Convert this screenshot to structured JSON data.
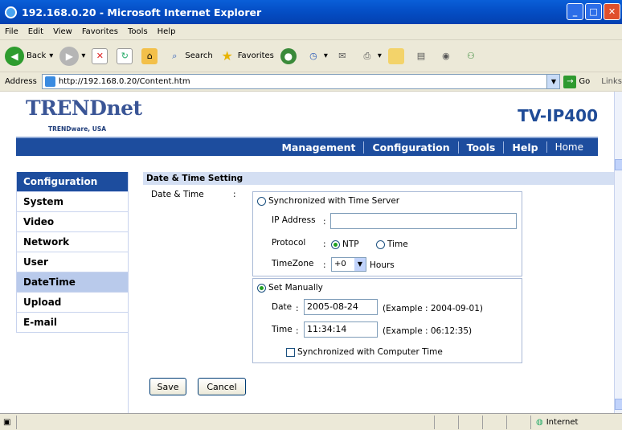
{
  "window": {
    "title": "192.168.0.20 - Microsoft Internet Explorer"
  },
  "menu": [
    "File",
    "Edit",
    "View",
    "Favorites",
    "Tools",
    "Help"
  ],
  "toolbar": {
    "back": "Back",
    "search": "Search",
    "favorites": "Favorites"
  },
  "address": {
    "label": "Address",
    "url": "http://192.168.0.20/Content.htm",
    "go": "Go",
    "links": "Links"
  },
  "brand": {
    "logo": "TRENDnet",
    "tagline": "TRENDware, USA",
    "model": "TV-IP400"
  },
  "nav": [
    "Management",
    "Configuration",
    "Tools",
    "Help",
    "Home"
  ],
  "sidebar": {
    "header": "Configuration",
    "items": [
      "System",
      "Video",
      "Network",
      "User",
      "DateTime",
      "Upload",
      "E-mail"
    ],
    "active": "DateTime"
  },
  "datetime": {
    "section_title": "Date & Time Setting",
    "label": "Date & Time",
    "colon": ":",
    "sync_server_label": "Synchronized with Time Server",
    "ip_label": "IP Address",
    "ip_value": "",
    "protocol_label": "Protocol",
    "protocol_ntp": "NTP",
    "protocol_time": "Time",
    "protocol_selected": "NTP",
    "timezone_label": "TimeZone",
    "timezone_value": "+0",
    "timezone_unit": "Hours",
    "manual_label": "Set Manually",
    "mode_selected": "manual",
    "date_label": "Date",
    "date_value": "2005-08-24",
    "date_example": "(Example : 2004-09-01)",
    "time_label": "Time",
    "time_value": "11:34:14",
    "time_example": "(Example : 06:12:35)",
    "sync_pc_label": "Synchronized with Computer Time",
    "sync_pc_checked": false
  },
  "buttons": {
    "save": "Save",
    "cancel": "Cancel"
  },
  "status": {
    "zone": "Internet"
  }
}
